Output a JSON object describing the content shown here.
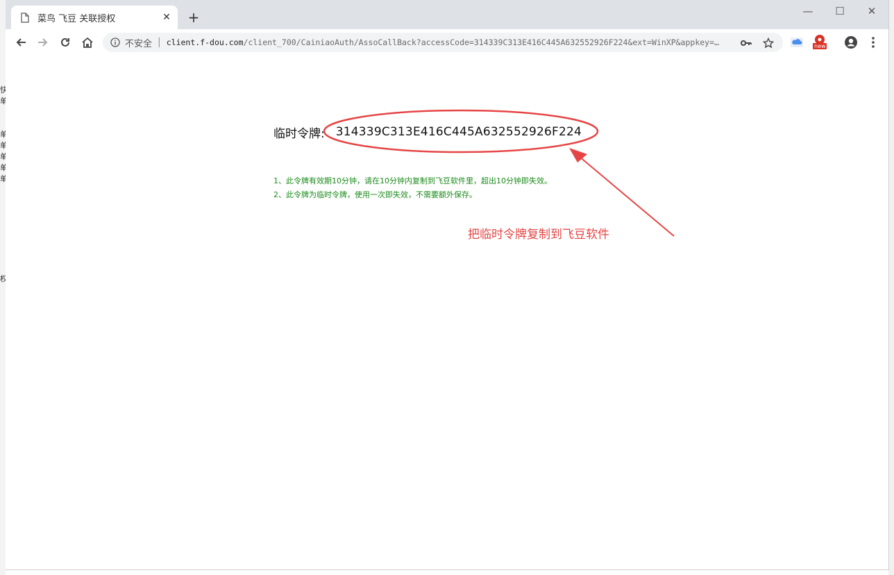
{
  "tab": {
    "title": "菜鸟 飞豆 关联授权"
  },
  "address_bar": {
    "security_label": "不安全",
    "url_host": "client.f-dou.com",
    "url_path": "/client_700/CainiaoAuth/AssoCallBack?accessCode=314339C313E416C445A632552926F224&ext=WinXP&appkey=…"
  },
  "extension_badge": "new",
  "page": {
    "token_label": "临时令牌:",
    "token_value": "314339C313E416C445A632552926F224",
    "note_1": "1、此令牌有效期10分钟，请在10分钟内复制到飞豆软件里，超出10分钟即失效。",
    "note_2": "2、此令牌为临时令牌，使用一次即失效，不需要额外保存。"
  },
  "annotation": {
    "text": "把临时令牌复制到飞豆软件",
    "color": "#e64545"
  },
  "background_window": {
    "fragments": [
      "快",
      "单",
      "单",
      "单",
      "单",
      "单",
      "单",
      "权"
    ]
  },
  "colors": {
    "note_green": "#1a8a1a",
    "annotation_red": "#e64545",
    "tab_strip": "#dee1e6"
  }
}
